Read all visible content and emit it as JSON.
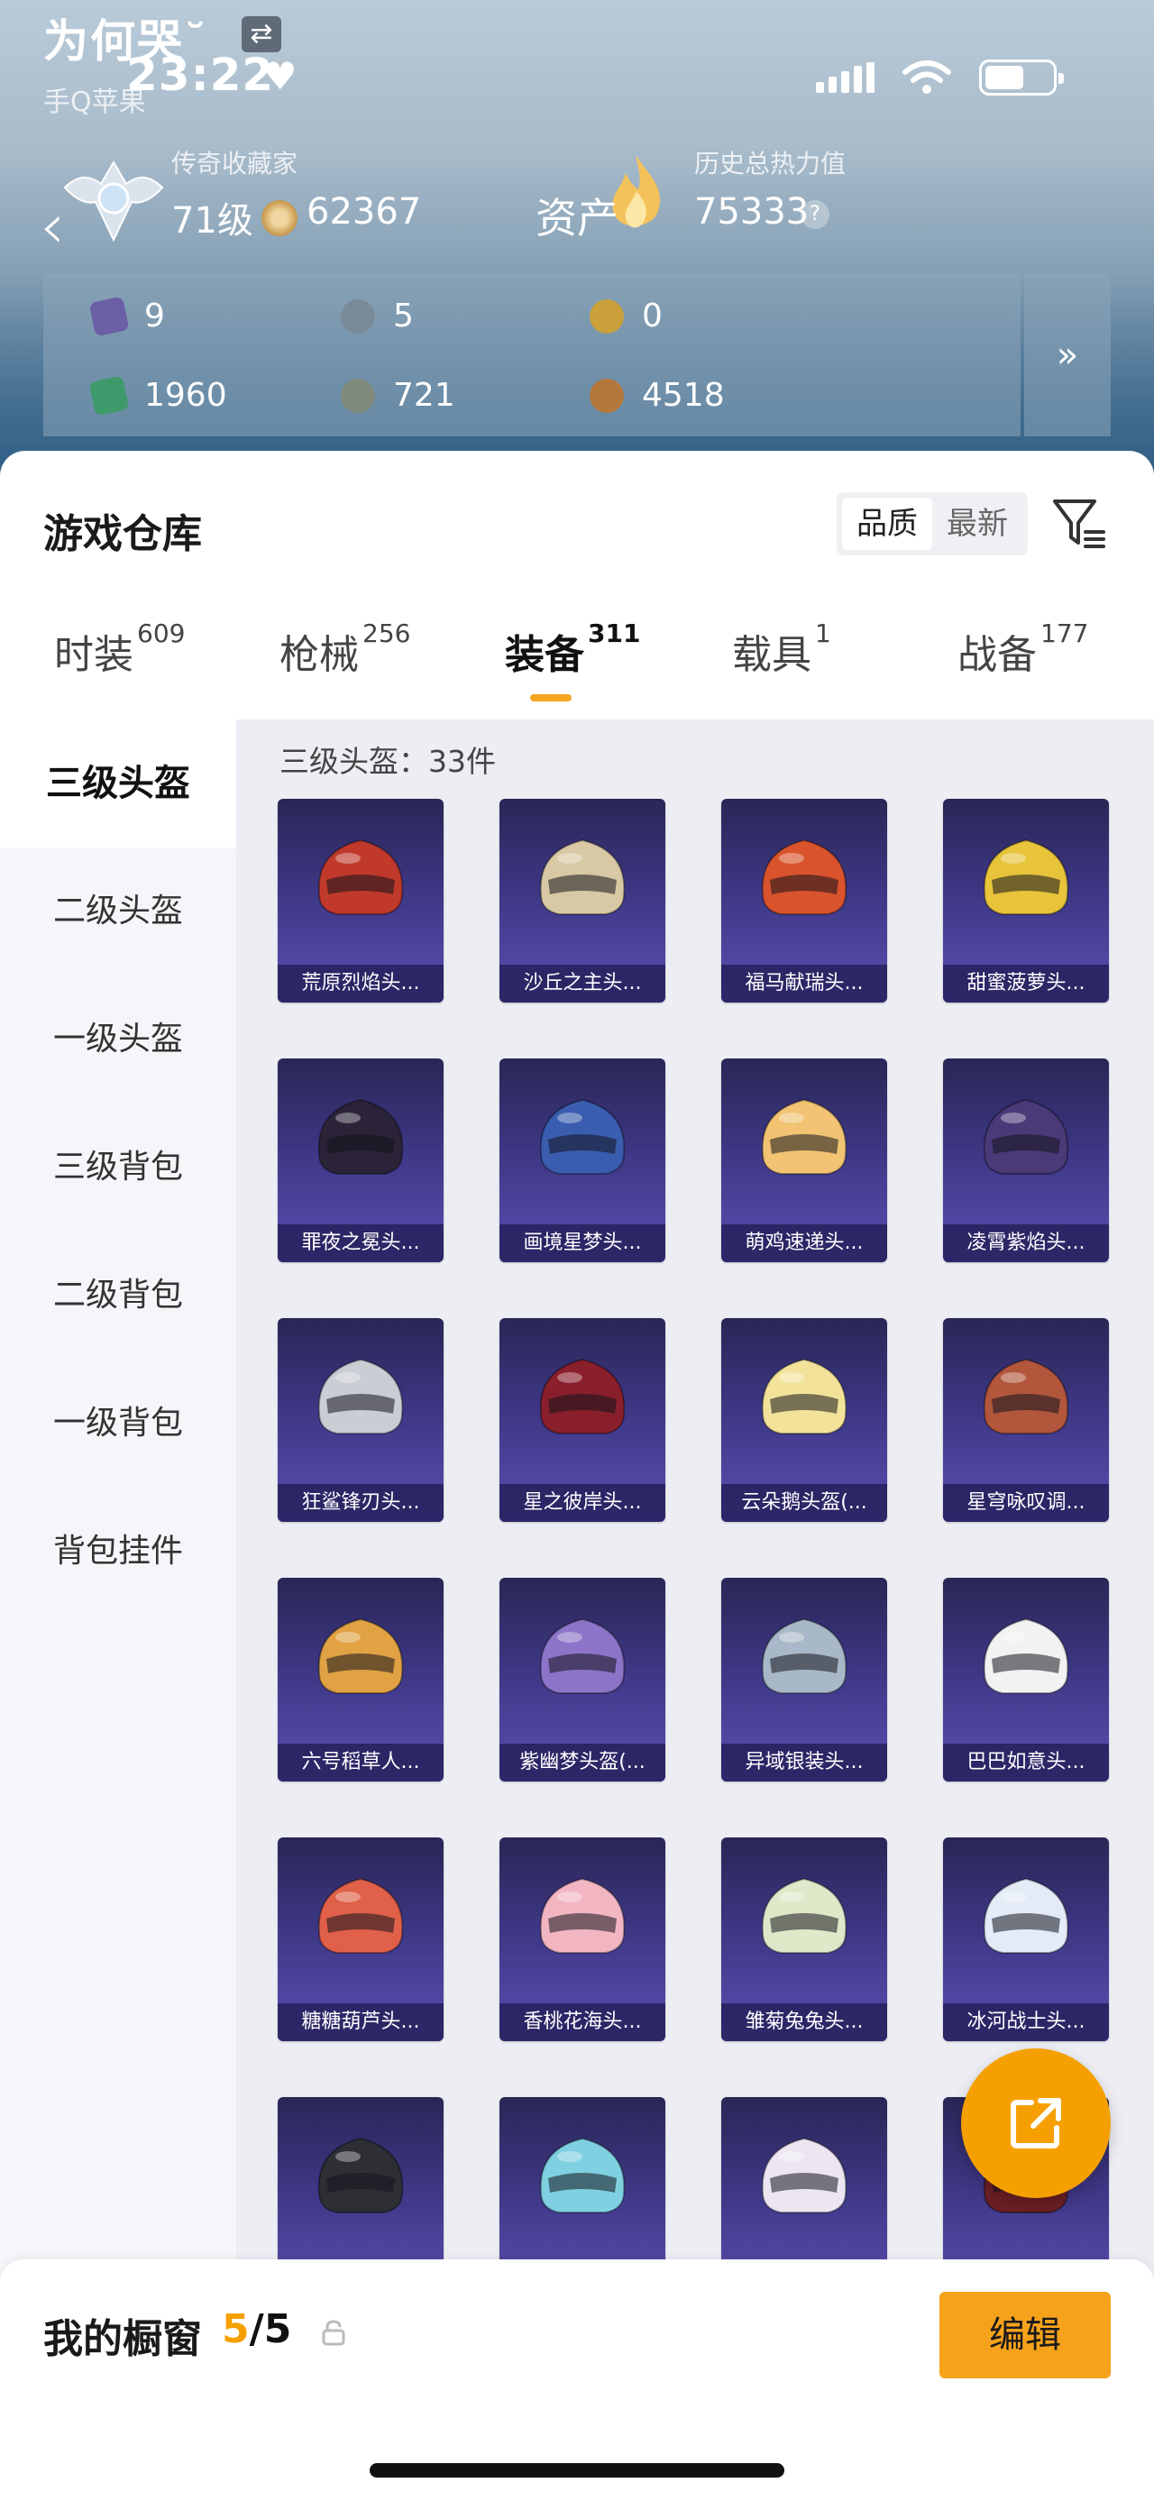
{
  "status_bar": {
    "time": "23:22"
  },
  "profile": {
    "name": "为何哭˘",
    "sub": "手Q苹果",
    "rank_title": "传奇收藏家",
    "level": "71级",
    "collection_points": "62367",
    "asset_label": "资产",
    "power_title": "历史总热力值",
    "power_value": "75333"
  },
  "currencies": [
    {
      "icon": "purple-card-icon",
      "value": "9",
      "color": "#6b5fa6"
    },
    {
      "icon": "silver-coin-icon",
      "value": "5",
      "color": "#7b8a98"
    },
    {
      "icon": "gold-coin-icon",
      "value": "0",
      "color": "#c9a03a"
    },
    {
      "icon": "green-ticket-icon",
      "value": "1960",
      "color": "#3f9a6b"
    },
    {
      "icon": "metal-medal-icon",
      "value": "721",
      "color": "#7f8a7c"
    },
    {
      "icon": "bronze-coin-icon",
      "value": "4518",
      "color": "#b4773c"
    }
  ],
  "warehouse": {
    "title": "游戏仓库",
    "sort": {
      "quality": "品质",
      "newest": "最新"
    },
    "tabs": [
      {
        "label": "时装",
        "count": "609"
      },
      {
        "label": "枪械",
        "count": "256"
      },
      {
        "label": "装备",
        "count": "311"
      },
      {
        "label": "载具",
        "count": "1"
      },
      {
        "label": "战备",
        "count": "177"
      }
    ],
    "side_nav": [
      "三级头盔",
      "二级头盔",
      "一级头盔",
      "三级背包",
      "二级背包",
      "一级背包",
      "背包挂件"
    ],
    "count_text": "三级头盔：33件",
    "items": [
      {
        "name": "荒原烈焰头...",
        "color": "#c0392b"
      },
      {
        "name": "沙丘之主头...",
        "color": "#d8c9a4"
      },
      {
        "name": "福马献瑞头...",
        "color": "#d9532c"
      },
      {
        "name": "甜蜜菠萝头...",
        "color": "#e7c43a"
      },
      {
        "name": "罪夜之冕头...",
        "color": "#2b2438"
      },
      {
        "name": "画境星梦头...",
        "color": "#3a5db0"
      },
      {
        "name": "萌鸡速递头...",
        "color": "#f1c372"
      },
      {
        "name": "凌霄紫焰头...",
        "color": "#4a3a78"
      },
      {
        "name": "狂鲨锋刃头...",
        "color": "#c9cdd4"
      },
      {
        "name": "星之彼岸头...",
        "color": "#8a1f2c"
      },
      {
        "name": "云朵鹅头盔(...",
        "color": "#f3e39a"
      },
      {
        "name": "星穹咏叹调...",
        "color": "#b2563c"
      },
      {
        "name": "六号稻草人...",
        "color": "#e0a243"
      },
      {
        "name": "紫幽梦头盔(...",
        "color": "#8d74c9"
      },
      {
        "name": "异域银装头...",
        "color": "#a9b8c8"
      },
      {
        "name": "巴巴如意头...",
        "color": "#f2f2f2"
      },
      {
        "name": "糖糖葫芦头...",
        "color": "#e06049"
      },
      {
        "name": "香桃花海头...",
        "color": "#f2b6c2"
      },
      {
        "name": "雏菊兔兔头...",
        "color": "#dfe8c9"
      },
      {
        "name": "冰河战士头...",
        "color": "#e3ecf6"
      },
      {
        "name": "",
        "color": "#2d2f35"
      },
      {
        "name": "",
        "color": "#7fd0e0"
      },
      {
        "name": "",
        "color": "#ece6f2"
      },
      {
        "name": "",
        "color": "#6a1f25"
      }
    ]
  },
  "showcase": {
    "title": "我的橱窗",
    "current": "5",
    "total": "/5",
    "edit_label": "编辑"
  }
}
